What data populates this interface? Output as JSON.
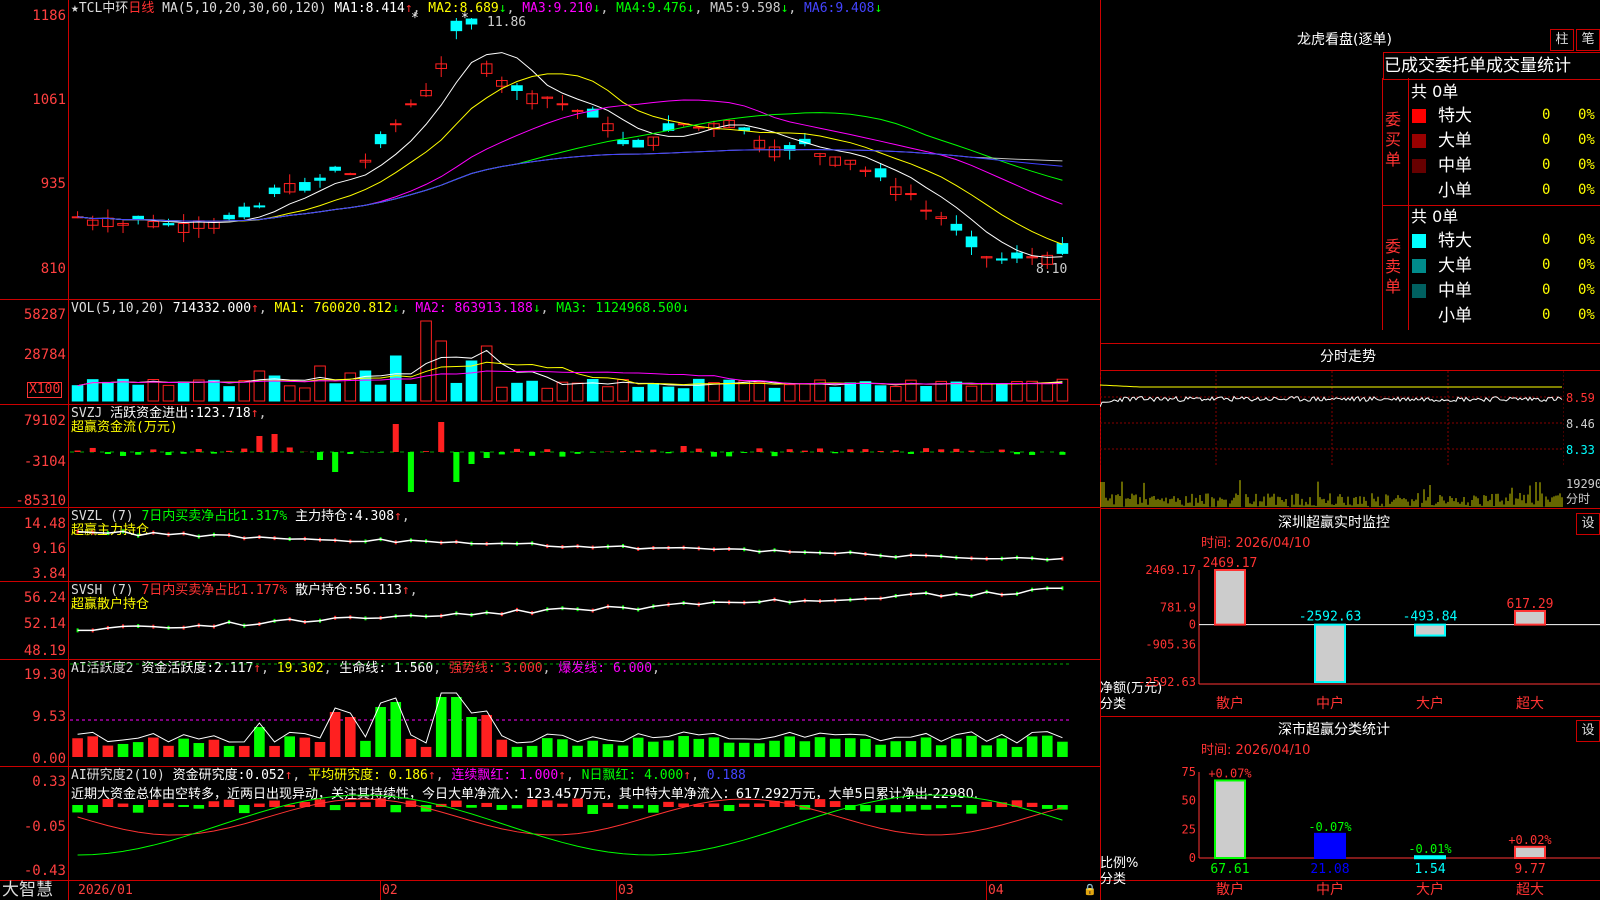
{
  "colors": {
    "up": "#ff2020",
    "down": "#00ffff",
    "grid": "#c00000",
    "ma1": "#ffffff",
    "ma2": "#ffff00",
    "ma3": "#ff00ff",
    "ma4": "#00ff00",
    "ma5": "#c0c0c0",
    "ma6": "#4040ff"
  },
  "main": {
    "title": "★TCL中环",
    "period": "日线",
    "ma_params": "MA(5,10,20,30,60,120)",
    "ma": [
      {
        "name": "MA1:",
        "value": "8.414",
        "arrow": "↑"
      },
      {
        "name": "MA2:",
        "value": "8.689",
        "arrow": "↓"
      },
      {
        "name": "MA3:",
        "value": "9.210",
        "arrow": "↓"
      },
      {
        "name": "MA4:",
        "value": "9.476",
        "arrow": "↓"
      },
      {
        "name": "MA5:",
        "value": "9.598",
        "arrow": "↓"
      },
      {
        "name": "MA6:",
        "value": "9.408",
        "arrow": "↓"
      }
    ],
    "y_ticks": [
      "1186",
      "1061",
      "935",
      "810"
    ],
    "high_label": "11.86",
    "low_label": "8.10",
    "star_marks": [
      "*",
      "*"
    ]
  },
  "vol": {
    "title": "VOL(5,10,20)",
    "value": "714332.000",
    "ma1": "MA1: 760020.812",
    "ma2": "MA2: 863913.188",
    "ma3": "MA3: 1124968.500",
    "y_ticks": [
      "58287",
      "28784"
    ],
    "unit": "X100"
  },
  "svzj": {
    "title": "SVZJ",
    "label": "活跃资金进出:",
    "value": "123.718",
    "sub": "超赢资金流(万元)",
    "y_ticks": [
      "79102",
      "-3104",
      "-85310"
    ]
  },
  "svzl": {
    "title": "SVZL (7)",
    "label1": "7日内买卖净占比1.317%",
    "label2": "主力持仓:",
    "value": "4.308",
    "sub": "超赢主力持仓",
    "y_ticks": [
      "14.48",
      "9.16",
      "3.84"
    ]
  },
  "svsh": {
    "title": "SVSH (7)",
    "label1": "7日内买卖净占比1.177%",
    "label2": "散户持仓:",
    "value": "56.113",
    "sub": "超赢散户持仓",
    "y_ticks": [
      "56.24",
      "52.14",
      "48.19"
    ]
  },
  "ai1": {
    "title": "AI活跃度2",
    "label": "资金活跃度:",
    "value": "2.117",
    "v2": "19.302",
    "lifeline": "生命线: 1.560",
    "strong": "强势线: 3.000",
    "burst": "爆发线: 6.000",
    "y_ticks": [
      "19.30",
      "9.53",
      "0.00"
    ]
  },
  "ai2": {
    "title": "AI研究度2(10)",
    "label": "资金研究度:",
    "value": "0.052",
    "avg": "平均研究度: 0.186",
    "cont": "连续飘红: 1.000",
    "nred": "N日飘红: 4.000",
    "last": "0.188",
    "y_ticks": [
      "0.33",
      "-0.05",
      "-0.43"
    ],
    "comment": "近期大资金总体由空转多，近两日出现异动，关注其持续性，今日大单净流入：123.457万元，其中特大单净流入：617.292万元，大单5日累计净出-22980."
  },
  "bottom": {
    "brand": "大智慧",
    "dates": [
      "2026/01",
      "02",
      "03",
      "04"
    ]
  },
  "right": {
    "lh_title": "龙虎看盘(逐单)",
    "btn_col": "柱",
    "btn_pen": "笔",
    "tab_label": "已成交委托单成交量统计",
    "buy_group": "委买单",
    "sell_group": "委卖单",
    "buy_total": "共 0单",
    "sell_total": "共 0单",
    "rows": [
      {
        "name": "特大",
        "count": "0",
        "pct": "0%",
        "color": "#ff0000"
      },
      {
        "name": "大单",
        "count": "0",
        "pct": "0%",
        "color": "#990000"
      },
      {
        "name": "中单",
        "count": "0",
        "pct": "0%",
        "color": "#660000"
      },
      {
        "name": "小单",
        "count": "0",
        "pct": "0%",
        "color": "#000000"
      }
    ],
    "sell_rows": [
      {
        "name": "特大",
        "count": "0",
        "pct": "0%",
        "color": "#00ffff"
      },
      {
        "name": "大单",
        "count": "0",
        "pct": "0%",
        "color": "#008b8b"
      },
      {
        "name": "中单",
        "count": "0",
        "pct": "0%",
        "color": "#006060"
      },
      {
        "name": "小单",
        "count": "0",
        "pct": "0%",
        "color": "#000000"
      }
    ],
    "intraday_title": "分时走势",
    "intraday_y": [
      "8.59",
      "8.46",
      "8.33"
    ],
    "intraday_vol": "19290",
    "intraday_vol_unit": "分时",
    "monitor_title": "深圳超赢实时监控",
    "monitor_set": "设",
    "monitor_time": "时间: 2026/04/10",
    "monitor_y": [
      "2469.17",
      "781.9",
      "0",
      "-905.36",
      "-2592.63"
    ],
    "monitor_axis": "净额(万元)",
    "monitor_cat_label": "分类",
    "monitor_bars": [
      {
        "cat": "散户",
        "value": 2469.17,
        "label": "2469.17"
      },
      {
        "cat": "中户",
        "value": -2592.63,
        "label": "-2592.63"
      },
      {
        "cat": "大户",
        "value": -493.84,
        "label": "-493.84"
      },
      {
        "cat": "超大",
        "value": 617.29,
        "label": "617.29"
      }
    ],
    "class_title": "深市超赢分类统计",
    "class_set": "设",
    "class_time": "时间: 2026/04/10",
    "class_y": [
      "75",
      "50",
      "25",
      "0"
    ],
    "class_axis": "比例%",
    "class_cat_label": "分类",
    "class_bars": [
      {
        "cat": "散户",
        "value": 67.61,
        "label": "67.61",
        "delta": "+0.07%"
      },
      {
        "cat": "中户",
        "value": 21.08,
        "label": "21.08",
        "delta": "-0.07%"
      },
      {
        "cat": "大户",
        "value": 1.54,
        "label": "1.54",
        "delta": "-0.01%"
      },
      {
        "cat": "超大",
        "value": 9.77,
        "label": "9.77",
        "delta": "+0.02%"
      }
    ]
  }
}
